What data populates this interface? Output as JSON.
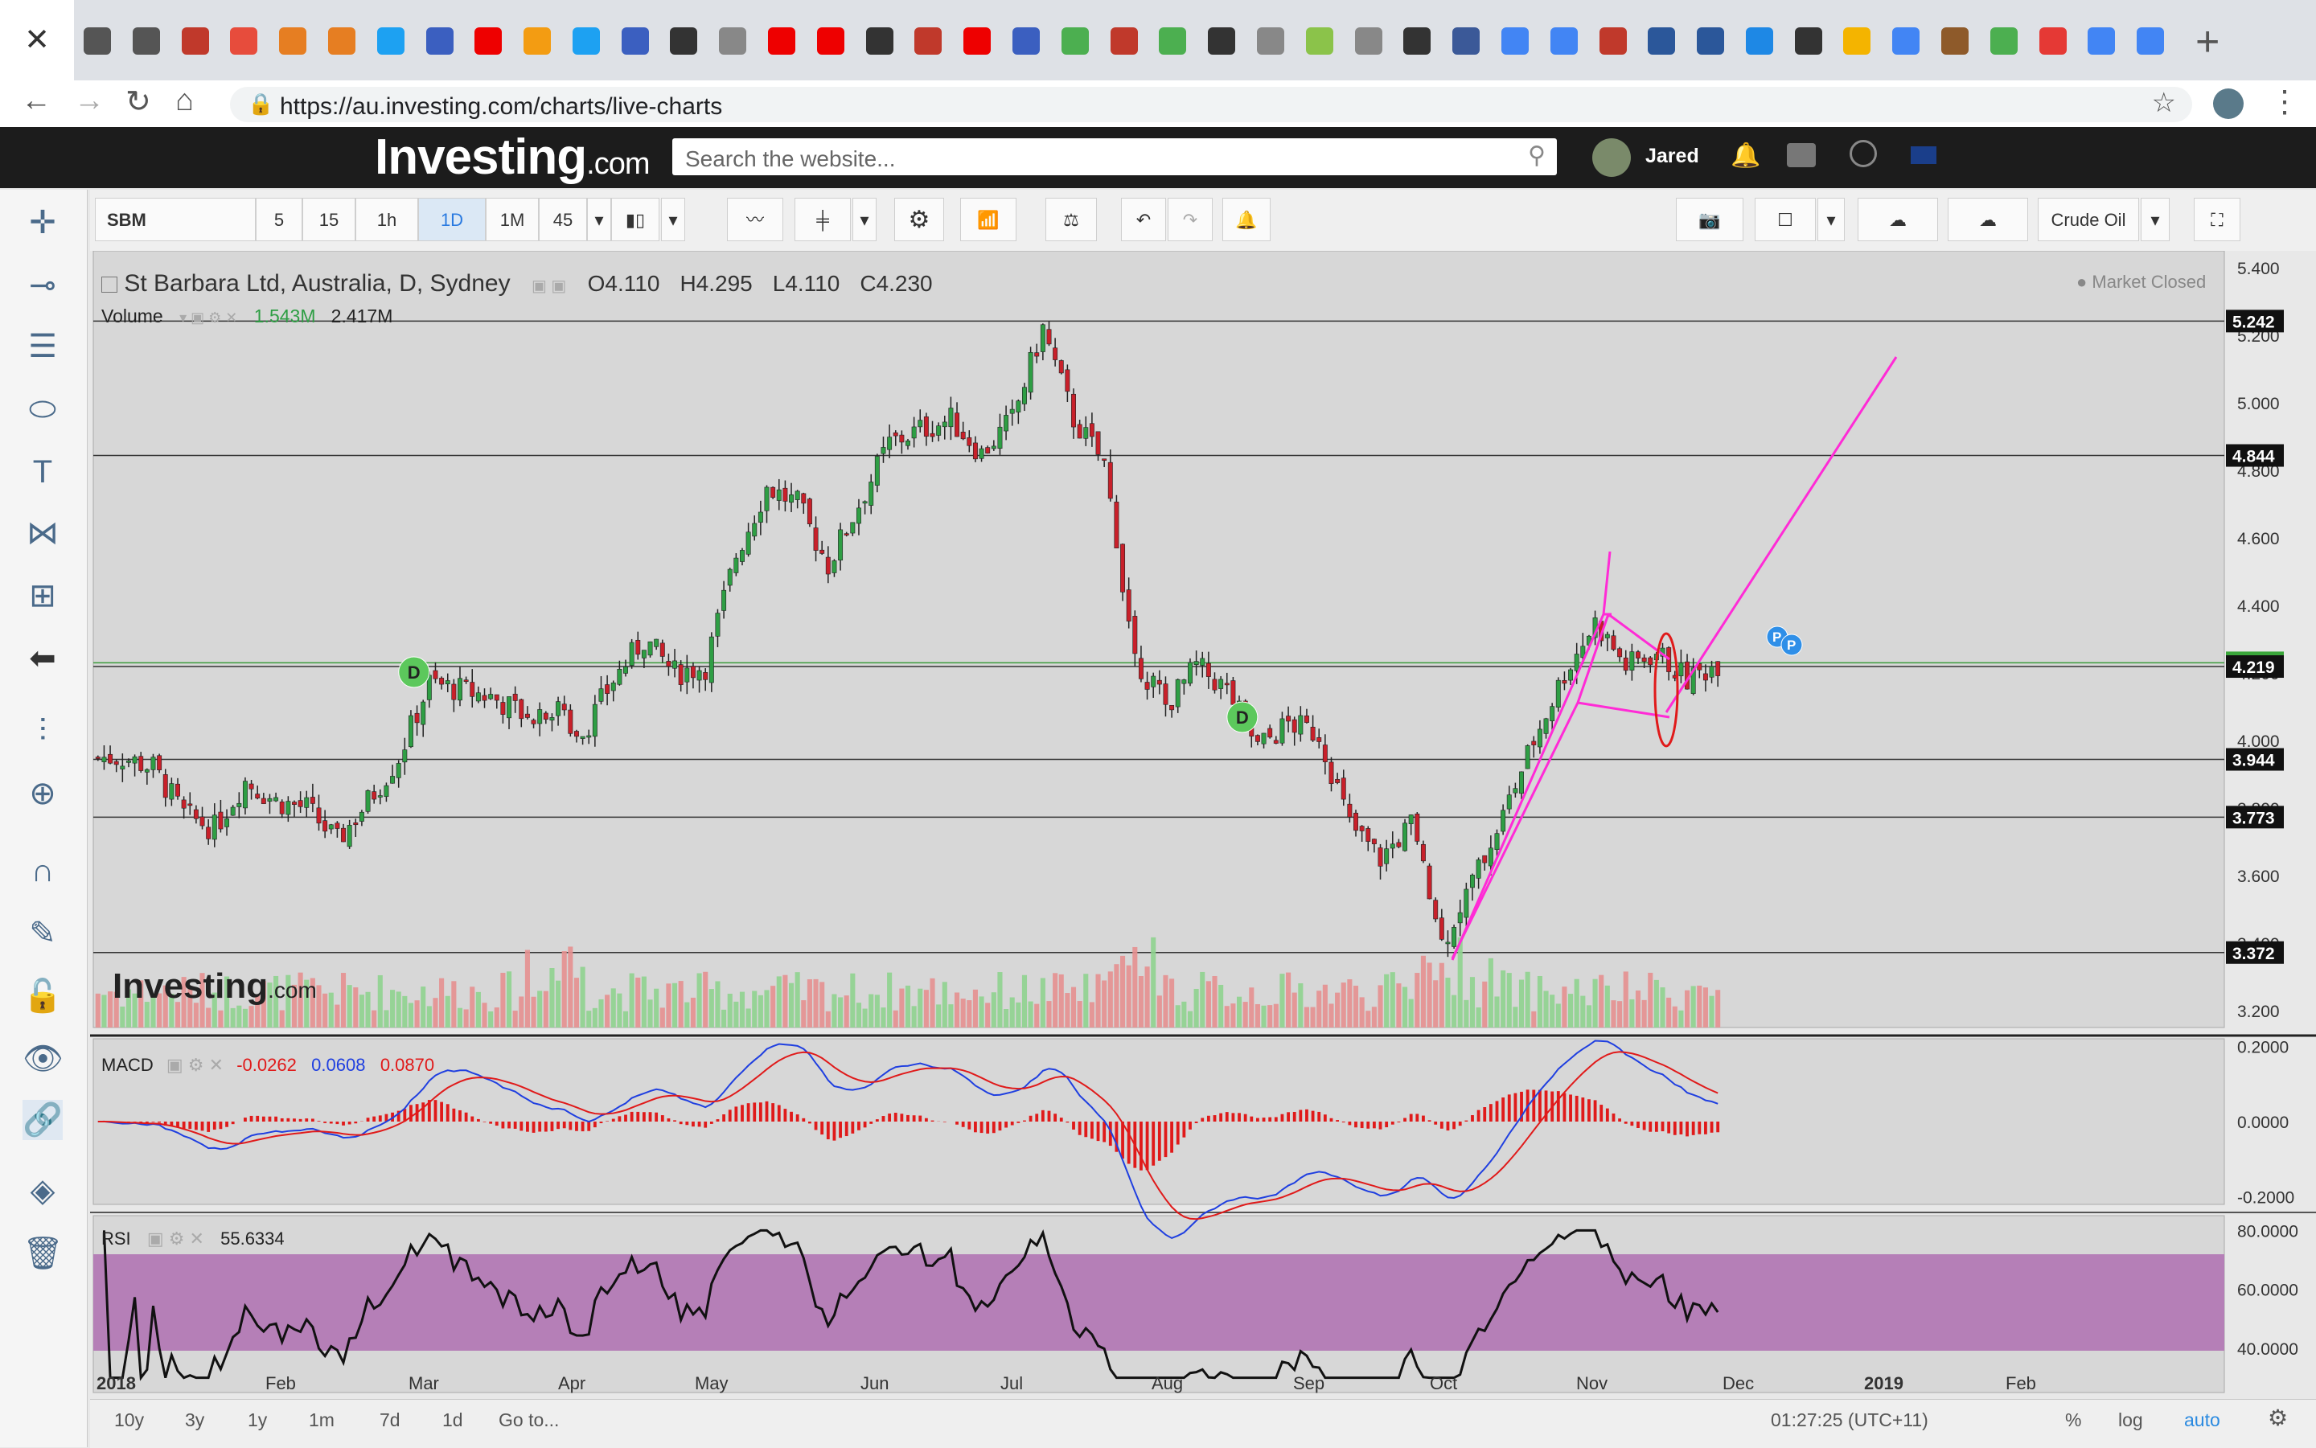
{
  "browser": {
    "url": "https://au.investing.com/charts/live-charts",
    "new_tab": "+",
    "close_tab": "✕"
  },
  "site": {
    "logo_main": "Investing",
    "logo_suffix": ".com",
    "search_placeholder": "Search the website...",
    "user_name": "Jared"
  },
  "toolbar": {
    "symbol": "SBM",
    "intervals": [
      "5",
      "15",
      "1h",
      "1D",
      "1M",
      "45"
    ],
    "active_interval": "1D",
    "compare_symbol": "Crude Oil"
  },
  "legend": {
    "title": "St Barbara Ltd, Australia, D, Sydney",
    "open": "O4.110",
    "high": "H4.295",
    "low": "L4.110",
    "close": "C4.230",
    "volume_label": "Volume",
    "volume_value": "1.543M",
    "volume_avg": "2.417M",
    "market_status": "Market Closed",
    "watermark_main": "Investing",
    "watermark_suffix": ".com"
  },
  "macd_legend": {
    "label": "MACD",
    "v1": "-0.0262",
    "v2": "0.0608",
    "v3": "0.0870"
  },
  "rsi_legend": {
    "label": "RSI",
    "value": "55.6334"
  },
  "footer": {
    "ranges": [
      "10y",
      "3y",
      "1y",
      "1m",
      "7d",
      "1d",
      "Go to..."
    ],
    "clock": "01:27:25 (UTC+11)",
    "pct": "%",
    "log": "log",
    "auto": "auto"
  },
  "colors": {
    "up": "#2e9e44",
    "down": "#c8202a",
    "pattern": "#ff2bd6",
    "macd": "#1f3fe0",
    "signal": "#e01a1a",
    "rsi_band": "#b57fb7"
  },
  "chart_data": {
    "type": "candlestick",
    "title": "St Barbara Ltd, Australia, D, Sydney",
    "x_tick_labels": [
      "2018",
      "Feb",
      "Mar",
      "Apr",
      "May",
      "Jun",
      "Jul",
      "Aug",
      "Sep",
      "Oct",
      "Nov",
      "Dec",
      "2019",
      "Feb"
    ],
    "price_axis": {
      "ticks": [
        "5.400",
        "5.200",
        "5.000",
        "4.800",
        "4.600",
        "4.400",
        "4.200",
        "4.000",
        "3.800",
        "3.600",
        "3.400",
        "3.200"
      ],
      "ylim": [
        3.15,
        5.45
      ]
    },
    "horizontal_levels": [
      {
        "label": "5.242",
        "value": 5.242
      },
      {
        "label": "4.844",
        "value": 4.844
      },
      {
        "label": "4.230",
        "value": 4.23,
        "current": true
      },
      {
        "label": "4.219",
        "value": 4.219
      },
      {
        "label": "3.944",
        "value": 3.944
      },
      {
        "label": "3.773",
        "value": 3.773
      },
      {
        "label": "3.372",
        "value": 3.372
      }
    ],
    "close_series_weekly": [
      3.95,
      3.92,
      3.78,
      3.74,
      3.88,
      3.82,
      3.8,
      3.7,
      3.82,
      3.95,
      4.17,
      4.15,
      4.13,
      4.08,
      4.1,
      4.02,
      4.18,
      4.3,
      4.2,
      4.22,
      4.55,
      4.75,
      4.7,
      4.52,
      4.7,
      4.88,
      4.92,
      4.95,
      4.85,
      4.95,
      5.22,
      4.95,
      4.82,
      4.25,
      4.1,
      4.22,
      4.15,
      3.98,
      4.05,
      4.02,
      3.75,
      3.65,
      3.75,
      3.4,
      3.58,
      3.78,
      4.0,
      4.2,
      4.35,
      4.22,
      4.26,
      4.18,
      4.23
    ],
    "markers": [
      {
        "label": "D",
        "week": 10
      },
      {
        "label": "D",
        "week": 37
      },
      {
        "label": "P",
        "week": 50
      },
      {
        "label": "P",
        "week": 51
      }
    ],
    "macd_axis": {
      "ticks": [
        "0.2000",
        "0.0000",
        "-0.2000"
      ]
    },
    "rsi_axis": {
      "ticks": [
        "80.0000",
        "60.0000",
        "40.0000"
      ]
    }
  }
}
